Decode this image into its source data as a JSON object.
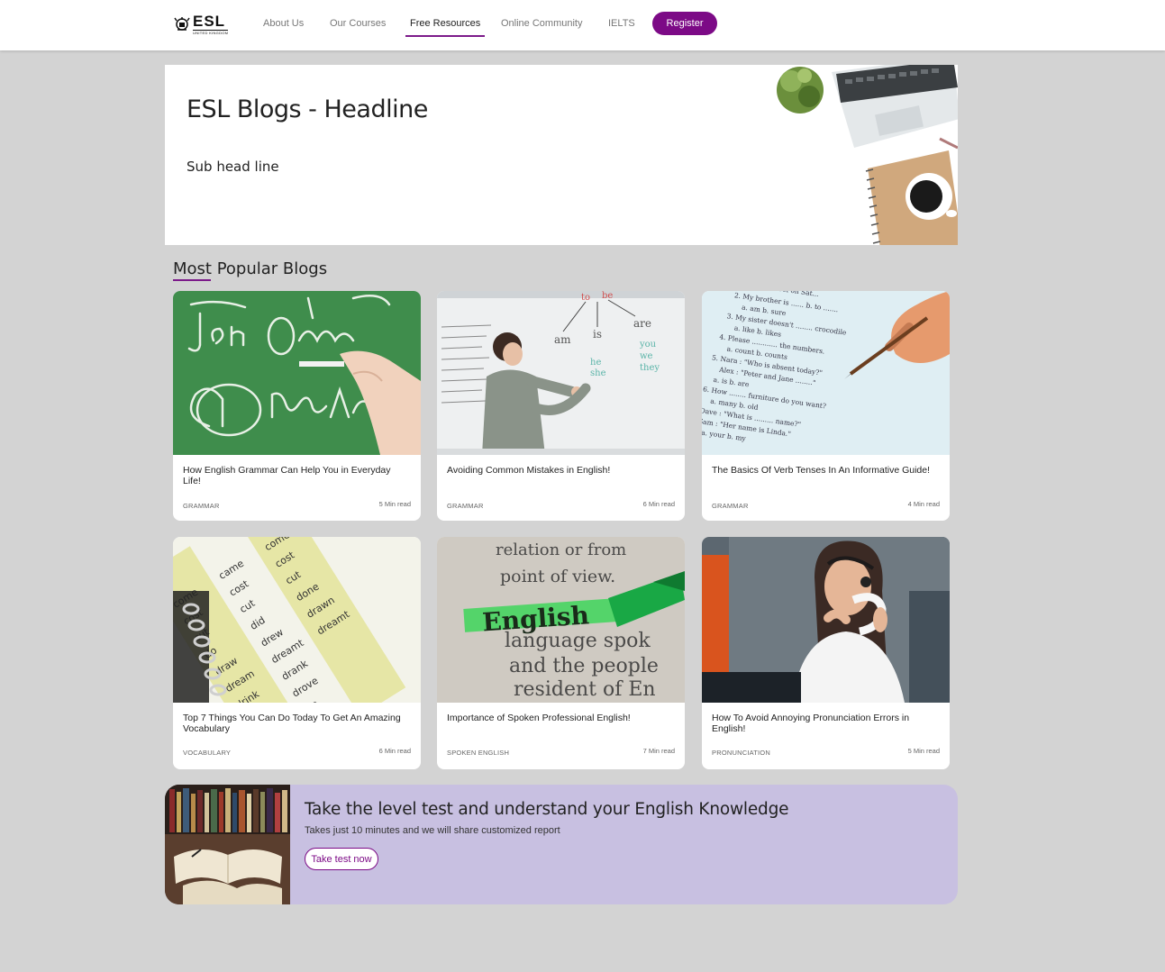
{
  "nav": {
    "logo_text": "ESL",
    "logo_sub": "UNITED KINGDOM",
    "links": [
      "About Us",
      "Our Courses",
      "Free Resources",
      "Online Community",
      "IELTS"
    ],
    "active": "Free Resources",
    "register_label": "Register"
  },
  "hero": {
    "title": "ESL Blogs - Headline",
    "subtitle": "Sub head line"
  },
  "section": {
    "title": "Most Popular Blogs"
  },
  "cards": [
    {
      "title": "How English Grammar Can Help You in Everyday Life!",
      "category": "GRAMMAR",
      "read_time": "5 Min read"
    },
    {
      "title": "Avoiding Common Mistakes in English!",
      "category": "GRAMMAR",
      "read_time": "6 Min read"
    },
    {
      "title": "The Basics Of Verb Tenses In An Informative Guide!",
      "category": "GRAMMAR",
      "read_time": "4 Min read"
    },
    {
      "title": "Top 7 Things You Can Do Today To Get An Amazing Vocabulary",
      "category": "VOCABULARY",
      "read_time": "6 Min read"
    },
    {
      "title": "Importance of Spoken Professional English!",
      "category": "SPOKEN ENGLISH",
      "read_time": "7 Min read"
    },
    {
      "title": "How To Avoid Annoying Pronunciation Errors in English!",
      "category": "PRONUNCIATION",
      "read_time": "5 Min read"
    }
  ],
  "cta": {
    "title": "Take the level test and understand your English Knowledge",
    "subtitle": "Takes just 10 minutes and we will share customized report",
    "button_label": "Take test now"
  },
  "colors": {
    "accent": "#7c0a86",
    "page_bg": "#d3d3d3",
    "cta_bg": "#c8c0e1"
  }
}
